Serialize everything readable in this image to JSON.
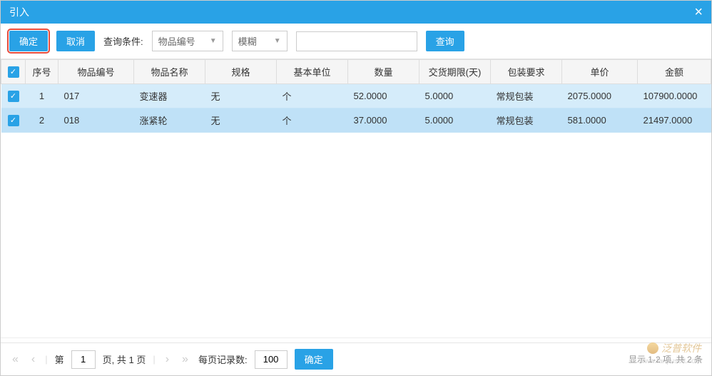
{
  "titlebar": {
    "title": "引入"
  },
  "toolbar": {
    "ok_label": "确定",
    "cancel_label": "取消",
    "search_condition_label": "查询条件:",
    "field_select": "物品编号",
    "match_select": "模糊",
    "search_value": "",
    "search_button": "查询"
  },
  "table": {
    "headers": [
      "序号",
      "物品编号",
      "物品名称",
      "规格",
      "基本单位",
      "数量",
      "交货期限(天)",
      "包装要求",
      "单价",
      "金额"
    ],
    "rows": [
      {
        "seq": "1",
        "code": "017",
        "name": "变速器",
        "spec": "无",
        "unit": "个",
        "qty": "52.0000",
        "leadtime": "5.0000",
        "package": "常规包装",
        "price": "2075.0000",
        "amount": "107900.0000"
      },
      {
        "seq": "2",
        "code": "018",
        "name": "涨紧轮",
        "spec": "无",
        "unit": "个",
        "qty": "37.0000",
        "leadtime": "5.0000",
        "package": "常规包装",
        "price": "581.0000",
        "amount": "21497.0000"
      }
    ]
  },
  "pagination": {
    "page_prefix": "第",
    "page_current": "1",
    "page_suffix": "页, 共 1 页",
    "page_size_label": "每页记录数:",
    "page_size_value": "100",
    "confirm_label": "确定",
    "info": "显示 1-2 项, 共 2 条"
  },
  "watermark": {
    "text": "泛普软件",
    "sub": "www.fanpusoft.com"
  }
}
